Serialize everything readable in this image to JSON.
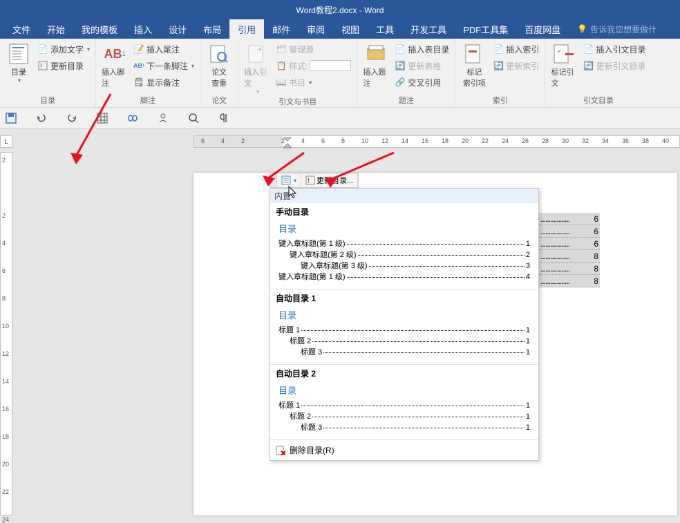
{
  "title": "Word教程2.docx - Word",
  "menu": {
    "file": "文件",
    "home": "开始",
    "templates": "我的模板",
    "insert": "插入",
    "design": "设计",
    "layout": "布局",
    "references": "引用",
    "mailings": "邮件",
    "review": "审阅",
    "view": "视图",
    "tools": "工具",
    "developer": "开发工具",
    "pdf": "PDF工具集",
    "baidu": "百度网盘",
    "tell": "告诉我您想要做什"
  },
  "ribbon": {
    "toc": {
      "btn": "目录",
      "addtext": "添加文字",
      "update": "更新目录",
      "group": "目录"
    },
    "footnote": {
      "insert": "插入脚注",
      "endnote": "插入尾注",
      "next": "下一条脚注",
      "show": "显示备注",
      "ab": "AB",
      "one": "1",
      "group": "脚注"
    },
    "lookup": {
      "btn": "论文\n查重",
      "group": "论文"
    },
    "citation": {
      "insert": "插入引文",
      "manage": "管理源",
      "style": "样式:",
      "biblio": "书目",
      "group": "引文与书目"
    },
    "caption": {
      "insert": "插入题注",
      "inserttoc": "插入表目录",
      "updatetoc": "更新表格",
      "crossref": "交叉引用",
      "group": "题注"
    },
    "index": {
      "mark": "标记\n索引项",
      "insert": "插入索引",
      "update": "更新索引",
      "group": "索引"
    },
    "authorities": {
      "mark": "标记引文",
      "insert": "插入引文目录",
      "update": "更新引文目录",
      "group": "引文目录"
    }
  },
  "hruler": [
    "6",
    "4",
    "2",
    "",
    "2",
    "4",
    "6",
    "8",
    "10",
    "12",
    "14",
    "16",
    "18",
    "20",
    "22",
    "24",
    "26",
    "28",
    "30",
    "32",
    "34",
    "36",
    "38",
    "40"
  ],
  "vruler": [
    "2",
    "",
    "2",
    "4",
    "6",
    "8",
    "10",
    "12",
    "14",
    "16",
    "18",
    "20",
    "22",
    "24"
  ],
  "toc_toolbar": {
    "update": "更新目录..."
  },
  "dropdown": {
    "builtin": "内置",
    "manual": {
      "title": "手动目录",
      "heading": "目录",
      "lines": [
        {
          "t": "键入章标题(第 1 级)",
          "p": "1",
          "l": 1
        },
        {
          "t": "键入章标题(第 2 级)",
          "p": "2",
          "l": 2
        },
        {
          "t": "键入章标题(第 3 级)",
          "p": "3",
          "l": 3
        },
        {
          "t": "键入章标题(第 1 级)",
          "p": "4",
          "l": 1
        }
      ]
    },
    "auto1": {
      "title": "自动目录 1",
      "heading": "目录",
      "lines": [
        {
          "t": "标题 1",
          "p": "1",
          "l": 1
        },
        {
          "t": "标题 2",
          "p": "1",
          "l": 2
        },
        {
          "t": "标题 3",
          "p": "1",
          "l": 3
        }
      ]
    },
    "auto2": {
      "title": "自动目录 2",
      "heading": "目录",
      "lines": [
        {
          "t": "标题 1",
          "p": "1",
          "l": 1
        },
        {
          "t": "标题 2",
          "p": "1",
          "l": 2
        },
        {
          "t": "标题 3",
          "p": "1",
          "l": 3
        }
      ]
    },
    "remove": "删除目录(R)"
  },
  "existing_pages": [
    "6",
    "6",
    "6",
    "8",
    "8",
    "8"
  ]
}
